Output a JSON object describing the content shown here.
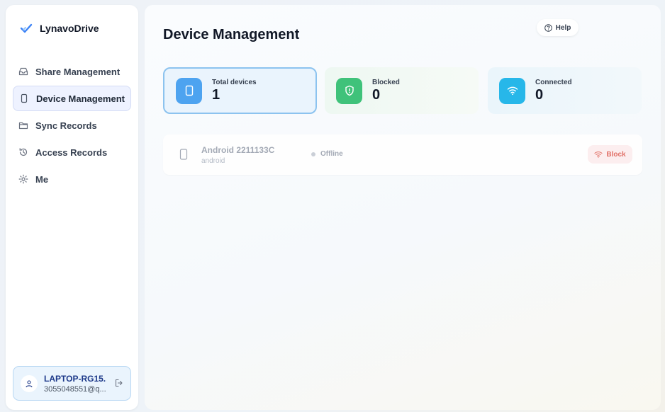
{
  "app": {
    "name": "LynavoDrive"
  },
  "sidebar": {
    "items": [
      {
        "label": "Share Management",
        "icon": "inbox-icon",
        "active": false
      },
      {
        "label": "Device Management",
        "icon": "phone-icon",
        "active": true
      },
      {
        "label": "Sync Records",
        "icon": "folder-icon",
        "active": false
      },
      {
        "label": "Access Records",
        "icon": "history-icon",
        "active": false
      },
      {
        "label": "Me",
        "icon": "gear-icon",
        "active": false
      }
    ],
    "user": {
      "name": "LAPTOP-RG15...",
      "email": "3055048551@q..."
    }
  },
  "main": {
    "title": "Device Management",
    "help_label": "Help",
    "stats": [
      {
        "label": "Total devices",
        "value": "1",
        "color": "#4da3f0",
        "icon": "phone-icon"
      },
      {
        "label": "Blocked",
        "value": "0",
        "color": "#3fc27a",
        "icon": "shield-icon"
      },
      {
        "label": "Connected",
        "value": "0",
        "color": "#27b7e9",
        "icon": "wifi-icon"
      }
    ],
    "devices": [
      {
        "name": "Android 2211133C",
        "os": "android",
        "status": "Offline",
        "action": "Block"
      }
    ]
  },
  "colors": {
    "accent": "#4da3f0",
    "danger": "#e0645a",
    "success": "#3fc27a"
  }
}
